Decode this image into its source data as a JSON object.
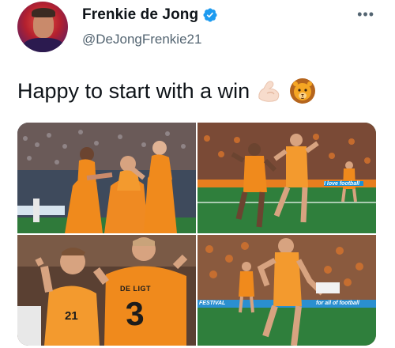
{
  "tweet": {
    "display_name": "Frenkie de Jong",
    "handle": "@DeJongFrenkie21",
    "text": "Happy to start with a win",
    "emojis": [
      "flexed-biceps-emoji",
      "lion-emoji"
    ],
    "more_label": "•••"
  },
  "media": {
    "photos": [
      {
        "id": "photo-1",
        "desc": "celebration-huddle"
      },
      {
        "id": "photo-2",
        "desc": "player-running-celebration"
      },
      {
        "id": "photo-3",
        "desc": "players-hugging"
      },
      {
        "id": "photo-4",
        "desc": "player-fists-celebration"
      }
    ],
    "jersey_texts": {
      "de_ligt_name": "DE LIGT",
      "de_ligt_number": "3",
      "de_jong_number": "21"
    },
    "board_texts": {
      "festival": "FESTIVAL",
      "football": "for all of football",
      "love": "I love football"
    }
  },
  "colors": {
    "accent": "#1d9bf0",
    "orange": "#f08a1c",
    "text": "#0f1419",
    "secondary": "#536471"
  }
}
